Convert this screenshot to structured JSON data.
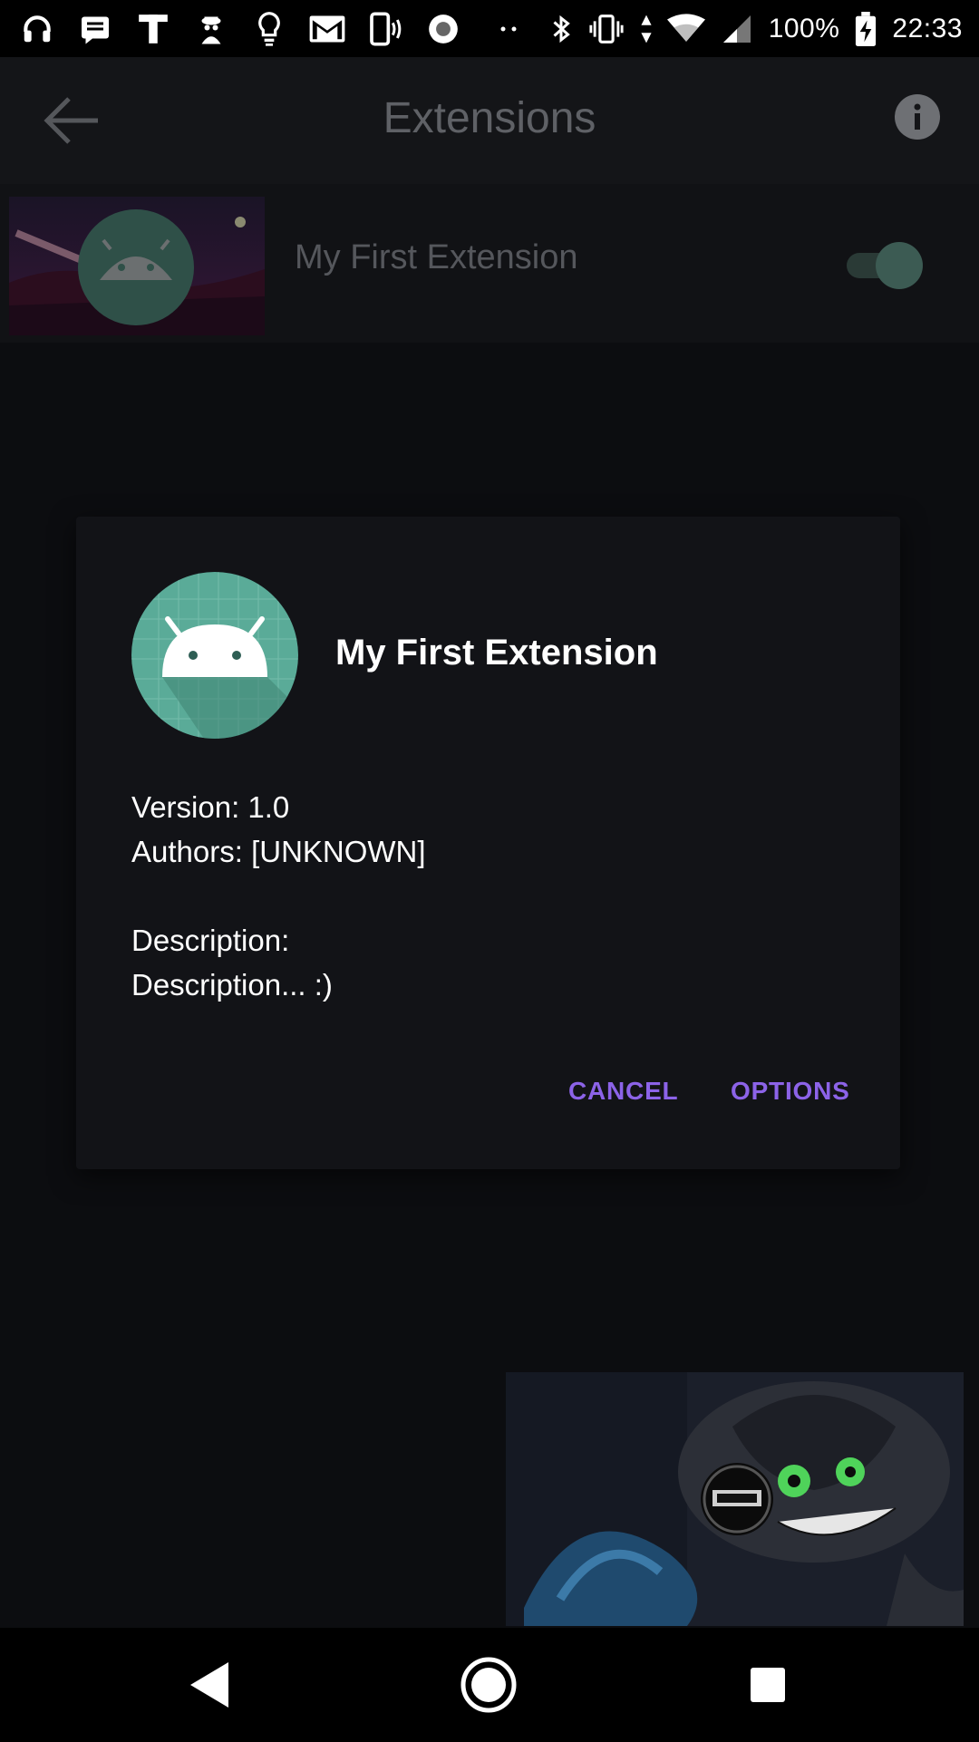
{
  "status_bar": {
    "battery": "100%",
    "time": "22:33",
    "icons": [
      "headphones-icon",
      "message-icon",
      "t-app-icon",
      "spy-icon",
      "lightbulb-icon",
      "gmail-icon",
      "phone-vibrate-icon",
      "record-icon",
      "more-dots-icon",
      "bluetooth-icon",
      "vibrate-icon",
      "data-arrows-icon",
      "wifi-icon",
      "signal-icon",
      "battery-charging-icon"
    ]
  },
  "toolbar": {
    "title": "Extensions",
    "back_icon": "arrow-left-icon",
    "info_icon": "info-icon"
  },
  "extension_list": {
    "items": [
      {
        "label": "My First Extension",
        "enabled": true
      }
    ]
  },
  "dialog": {
    "title": "My First Extension",
    "version_line": "Version: 1.0",
    "authors_line": "Authors: [UNKNOWN]",
    "description_label": "Description:",
    "description_text": "Description... :)",
    "cancel_label": "CANCEL",
    "options_label": "OPTIONS"
  },
  "colors": {
    "accent": "#8c63e8",
    "icon_teal": "#5aab98",
    "dialog_bg": "#121317"
  },
  "nav_bar": {
    "icons": [
      "nav-back-icon",
      "nav-home-icon",
      "nav-recents-icon"
    ]
  }
}
